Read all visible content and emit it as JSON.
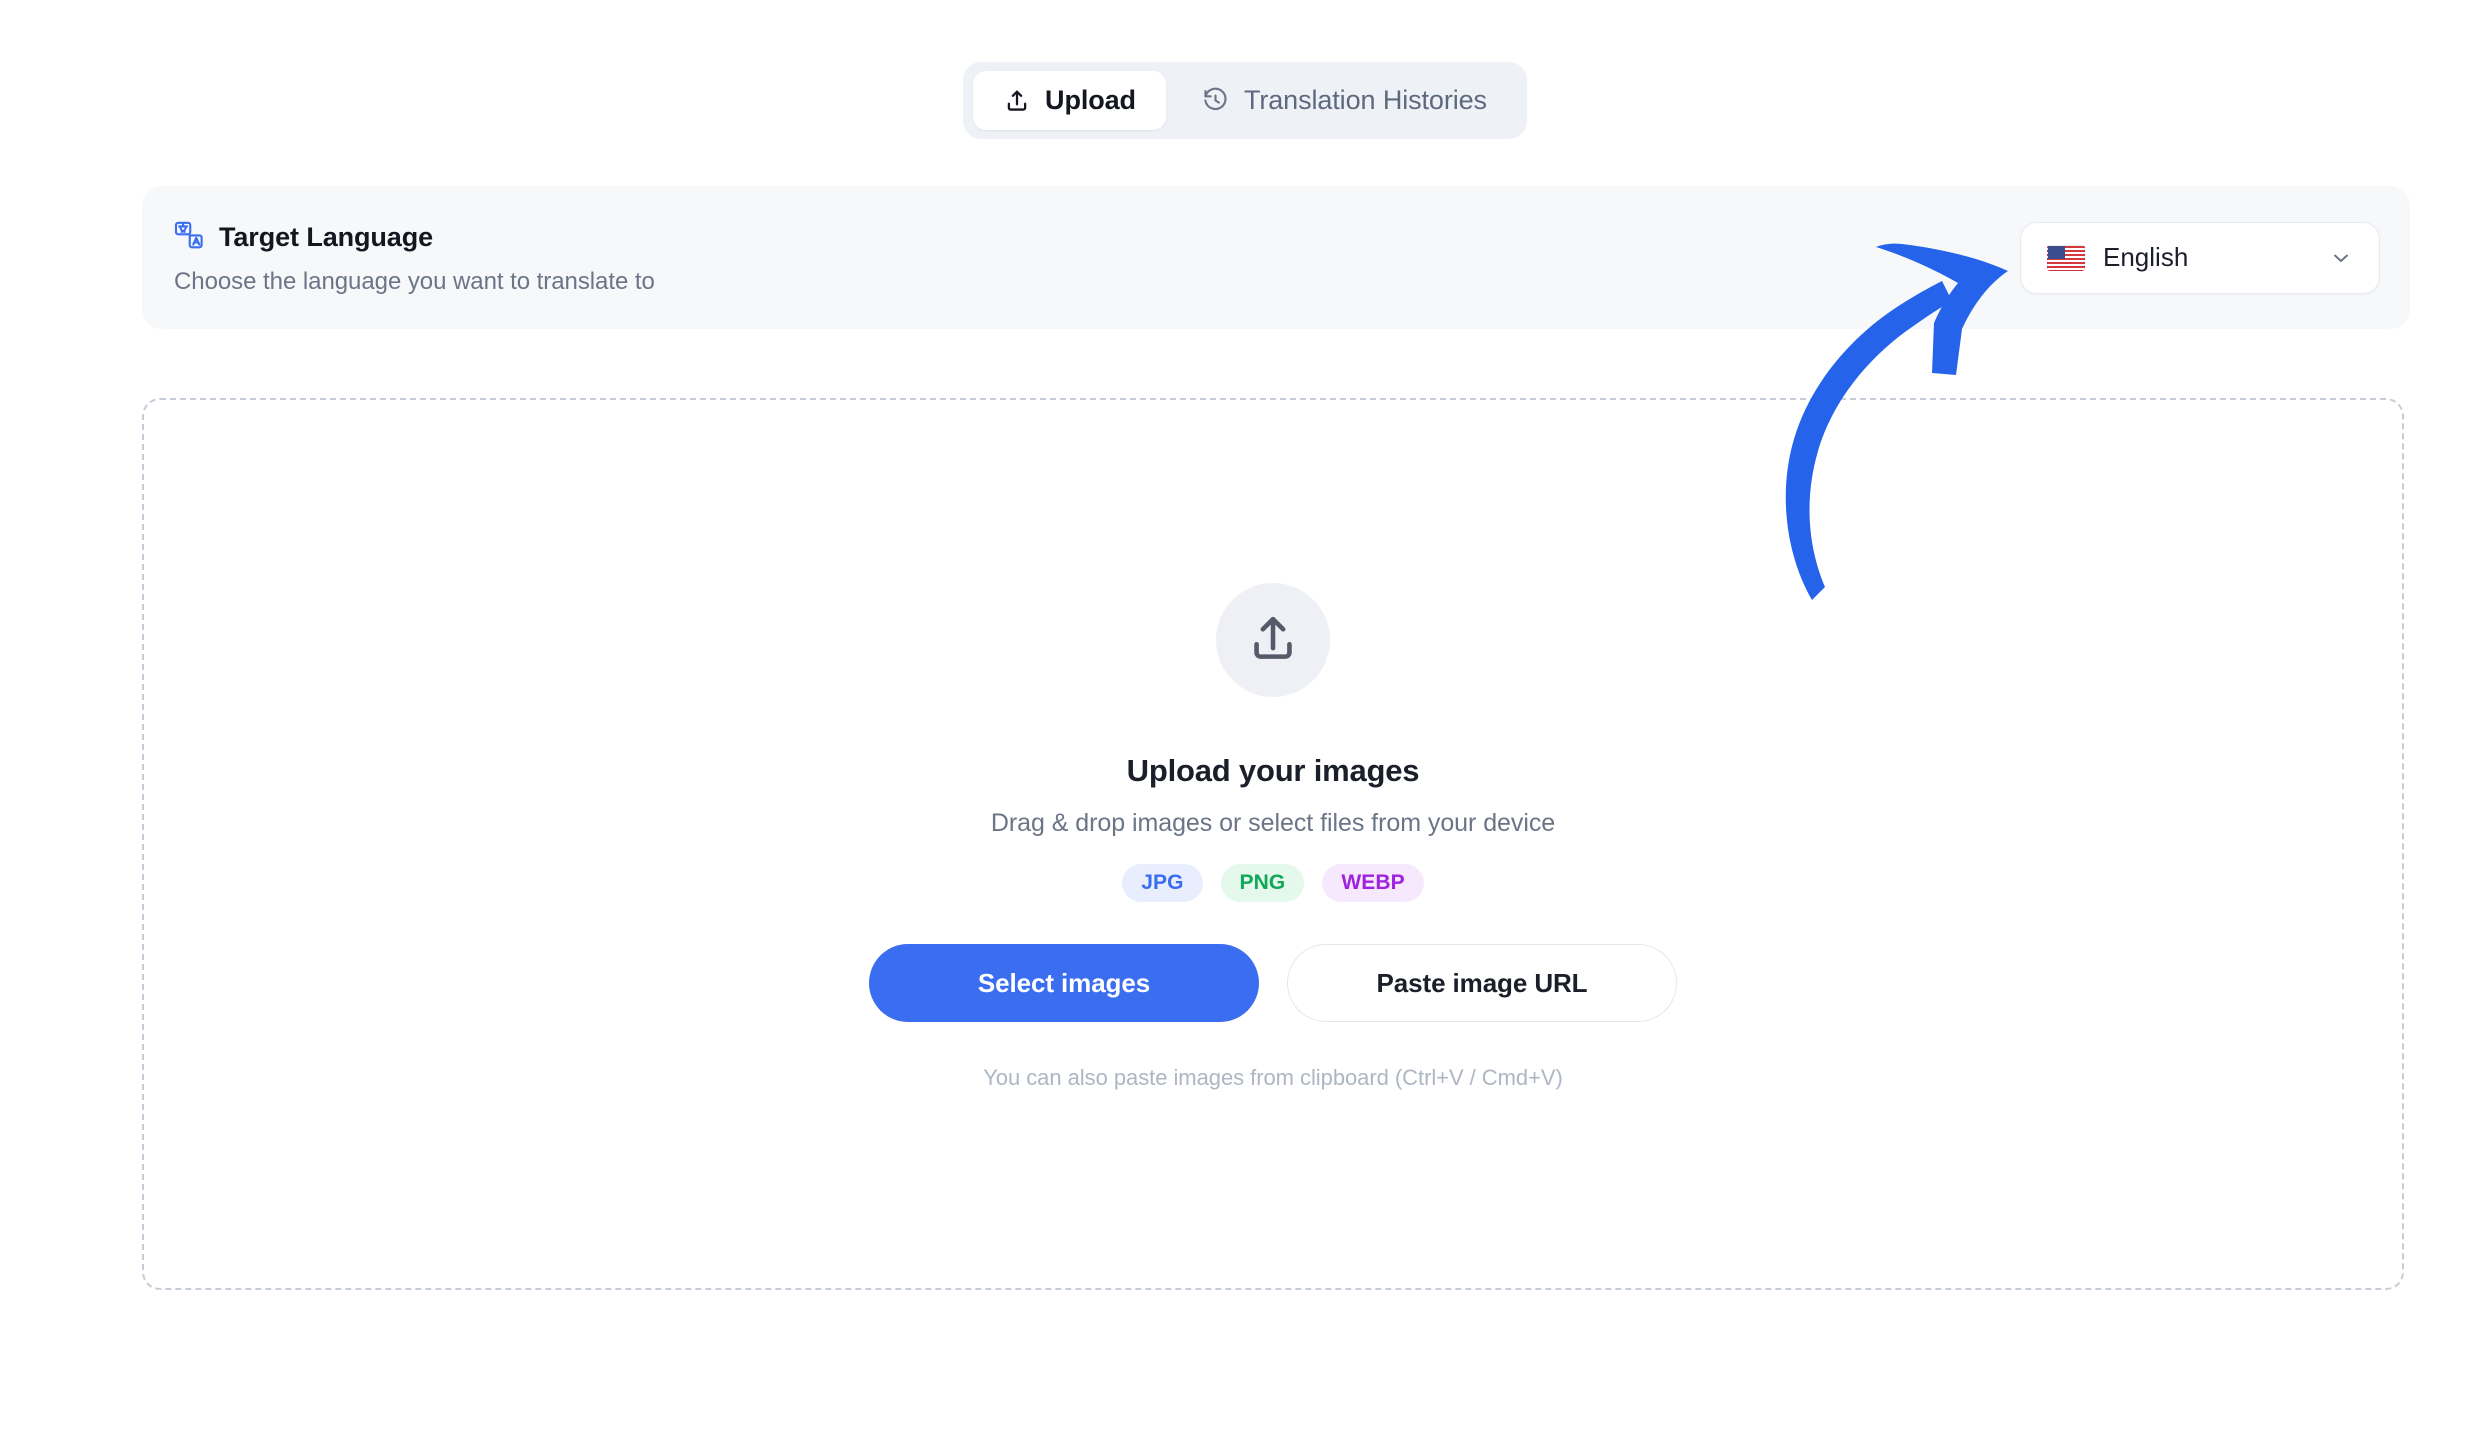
{
  "app": {
    "accent_color": "#3b6df0",
    "background": "#ffffff"
  },
  "tabs": {
    "items": [
      {
        "id": "upload",
        "label": "Upload",
        "icon": "upload-icon",
        "active": true
      },
      {
        "id": "histories",
        "label": "Translation Histories",
        "icon": "history-clock-icon",
        "active": false
      }
    ]
  },
  "target_language": {
    "icon": "translate-icon",
    "title": "Target Language",
    "subtitle": "Choose the language you want to translate to",
    "select": {
      "flag": "🇺🇸",
      "value": "English",
      "chevron": "chevron-down-icon"
    }
  },
  "dropzone": {
    "icon": "upload-arrow-icon",
    "title": "Upload your images",
    "subtitle": "Drag & drop images or select files from your device",
    "formats": [
      {
        "label": "JPG",
        "color": "#3b6df0",
        "background": "#e8eefd"
      },
      {
        "label": "PNG",
        "color": "#0fa958",
        "background": "#e4f8ec"
      },
      {
        "label": "WEBP",
        "color": "#a021e0",
        "background": "#f6e9fd"
      }
    ],
    "primary_button": "Select images",
    "secondary_button": "Paste image URL",
    "hint": "You can also paste images from clipboard (Ctrl+V / Cmd+V)"
  },
  "annotation": {
    "type": "curved-arrow",
    "color": "#2563eb",
    "points_to": "target-language-select"
  }
}
